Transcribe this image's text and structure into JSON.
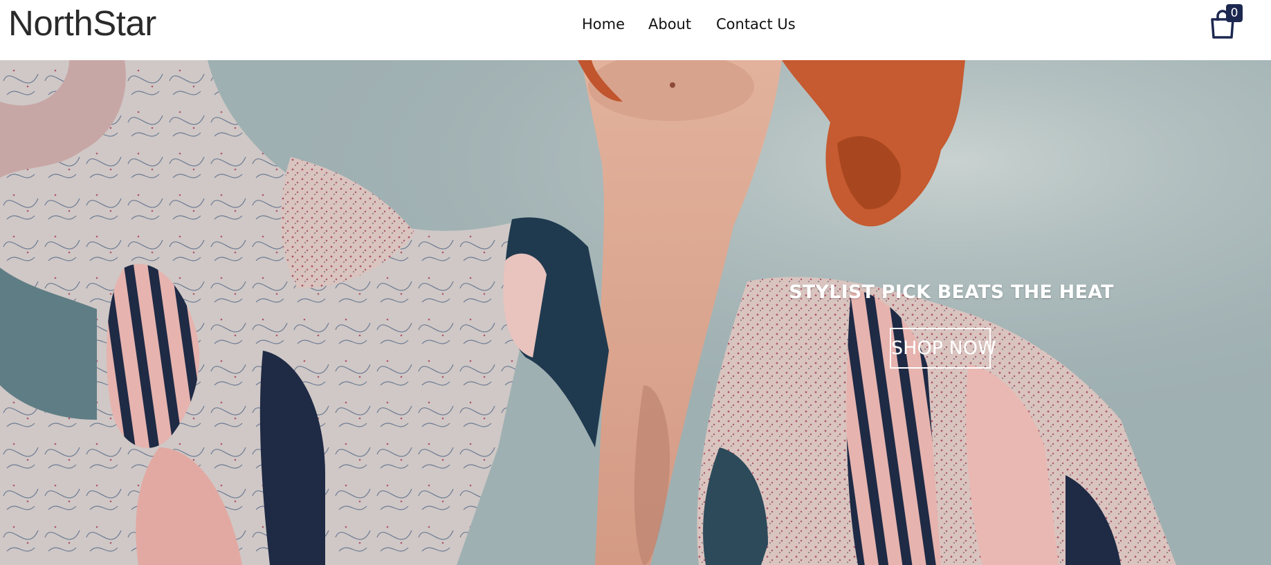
{
  "brand": {
    "name": "NorthStar"
  },
  "nav": {
    "items": [
      {
        "label": "Home"
      },
      {
        "label": "About"
      },
      {
        "label": "Contact Us"
      }
    ]
  },
  "cart": {
    "icon": "shopping-bag-icon",
    "count": "0",
    "badge_color": "#1d2850"
  },
  "hero": {
    "headline": "STYLIST PICK BEATS THE HEAT",
    "cta_label": "SHOP NOW",
    "image": "model-in-patterned-shirt"
  }
}
